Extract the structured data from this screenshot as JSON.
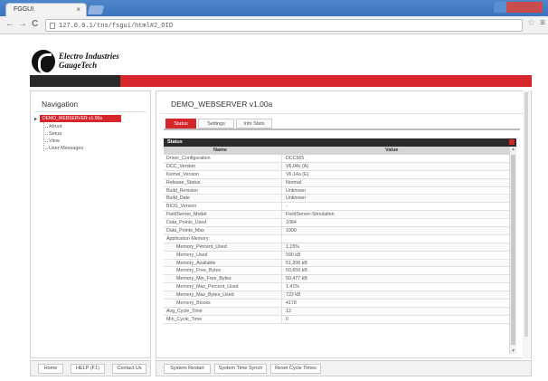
{
  "browser": {
    "tab_title": "FGGUI",
    "tab_close": "×",
    "url": "127.0.0.1/tns/fsgui/html#2_OID",
    "back_glyph": "←",
    "forward_glyph": "→",
    "reload_glyph": "C",
    "star_glyph": "☆",
    "menu_glyph": "≡"
  },
  "header": {
    "logo_line1": "Electro Industries",
    "logo_line2": "GaugeTech",
    "accent_color": "#d5262b"
  },
  "navigation": {
    "title": "Navigation",
    "expander": "▸",
    "root_label": "DEMO_WEBSERVER v1.00a",
    "items": [
      "About",
      "Setup",
      "View",
      "User Messages"
    ],
    "footer_buttons": [
      "Home",
      "HELP (F1)",
      "Contact Us"
    ]
  },
  "main": {
    "title": "DEMO_WEBSERVER v1.00a",
    "tabs": [
      "Status",
      "Settings",
      "Info Stats"
    ],
    "section_title": "Status",
    "columns": [
      "Name",
      "Value"
    ],
    "rows": [
      {
        "name": "Driver_Configuration",
        "value": "DCC565",
        "indent": false
      },
      {
        "name": "DCC_Version",
        "value": "V6.04c (A)",
        "indent": false
      },
      {
        "name": "Kernel_Version",
        "value": "V6.14a (E)",
        "indent": false
      },
      {
        "name": "Release_Status",
        "value": "Normal",
        "indent": false
      },
      {
        "name": "Build_Revision",
        "value": "Unknown",
        "indent": false
      },
      {
        "name": "Build_Date",
        "value": "Unknown",
        "indent": false
      },
      {
        "name": "BIOS_Version",
        "value": "-",
        "indent": false
      },
      {
        "name": "FieldServer_Model",
        "value": "FieldServer-Simulation",
        "indent": false
      },
      {
        "name": "Data_Points_Used",
        "value": "1084",
        "indent": false
      },
      {
        "name": "Data_Points_Max",
        "value": "1000",
        "indent": false
      },
      {
        "name": "Application Memory:",
        "value": "",
        "indent": false
      },
      {
        "name": "Memory_Percent_Used",
        "value": "1.15%",
        "indent": true
      },
      {
        "name": "Memory_Used",
        "value": "590 kB",
        "indent": true
      },
      {
        "name": "Memory_Available",
        "value": "51,206 kB",
        "indent": true
      },
      {
        "name": "Memory_Free_Bytes",
        "value": "50,659 kB",
        "indent": true
      },
      {
        "name": "Memory_Min_Free_Bytes",
        "value": "50,477 kB",
        "indent": true
      },
      {
        "name": "Memory_Max_Percent_Used",
        "value": "1.41%",
        "indent": true
      },
      {
        "name": "Memory_Max_Bytes_Used",
        "value": "722 kB",
        "indent": true
      },
      {
        "name": "Memory_Blocks",
        "value": "4178",
        "indent": true
      },
      {
        "name": "Avg_Cycle_Time",
        "value": "12",
        "indent": false
      },
      {
        "name": "Min_Cycle_Time",
        "value": "0",
        "indent": false
      }
    ],
    "footer_buttons": [
      "System Restart",
      "System Time Synch",
      "Reset Cycle Times"
    ]
  }
}
